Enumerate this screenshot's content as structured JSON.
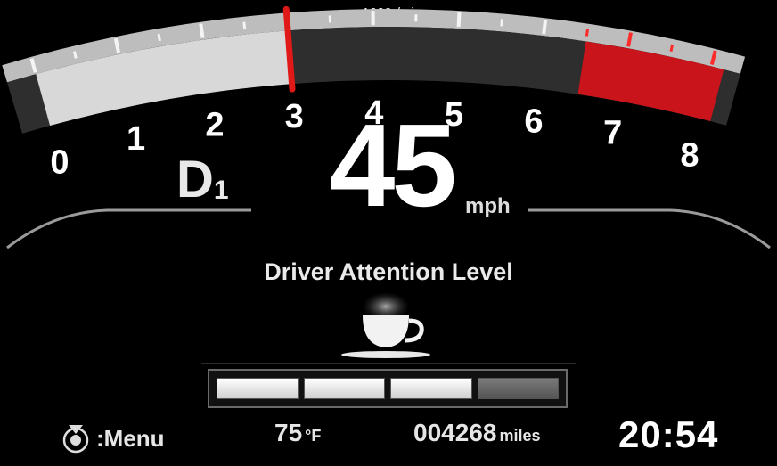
{
  "tachometer": {
    "unit_label": "x1000r/min",
    "scale_labels": [
      "0",
      "1",
      "2",
      "3",
      "4",
      "5",
      "6",
      "7",
      "8"
    ],
    "current_rpm_thousands": 3.0,
    "redline_from_thousands": 6.5,
    "colors": {
      "fill": "#d8d8d8",
      "redline": "#c8141a",
      "needle": "#e01818"
    }
  },
  "gear": {
    "letter": "D",
    "number": "1"
  },
  "speed": {
    "value": "45",
    "unit": "mph"
  },
  "attention": {
    "title": "Driver Attention Level",
    "icon": "coffee-cup-icon",
    "segments_total": 4,
    "segments_on": 3
  },
  "status_bar": {
    "menu_label": ":Menu",
    "menu_icon": "steering-control-icon",
    "temperature": "75",
    "temperature_unit": "°F",
    "odometer": "004268",
    "odometer_unit": "miles",
    "clock": "20:54"
  }
}
